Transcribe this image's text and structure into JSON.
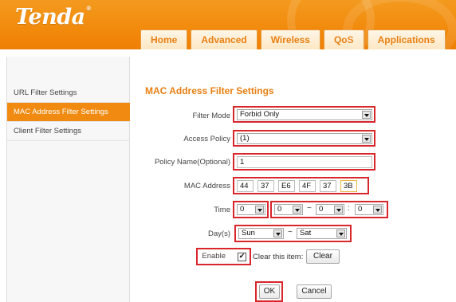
{
  "header": {
    "logo": "Tenda",
    "logo_mark": "®",
    "tabs": [
      "Home",
      "Advanced",
      "Wireless",
      "QoS",
      "Applications"
    ]
  },
  "sidebar": {
    "items": [
      {
        "label": "URL Filter Settings",
        "active": false
      },
      {
        "label": "MAC Address Filter Settings",
        "active": true
      },
      {
        "label": "Client Filter Settings",
        "active": false
      }
    ]
  },
  "form": {
    "title": "MAC Address Filter Settings",
    "filter_mode_label": "Filter Mode",
    "filter_mode_value": "Forbid Only",
    "access_policy_label": "Access Policy",
    "access_policy_value": "(1)",
    "policy_name_label": "Policy Name(Optional)",
    "policy_name_value": "1",
    "mac_label": "MAC Address",
    "mac": [
      "44",
      "37",
      "E6",
      "4F",
      "37",
      "3B"
    ],
    "time_label": "Time",
    "time": [
      "0",
      "0",
      "0",
      "0"
    ],
    "time_sep": ":",
    "time_range_sep": "~",
    "days_label": "Day(s)",
    "day_from": "Sun",
    "day_to": "Sat",
    "day_sep": "~",
    "enable_label": "Enable",
    "enable_checked": true,
    "check_mark": "✔",
    "clear_item_label": "Clear this item:",
    "clear_button": "Clear",
    "ok_button": "OK",
    "cancel_button": "Cancel"
  },
  "colors": {
    "accent": "#f08a10",
    "highlight": "#d8262a"
  }
}
